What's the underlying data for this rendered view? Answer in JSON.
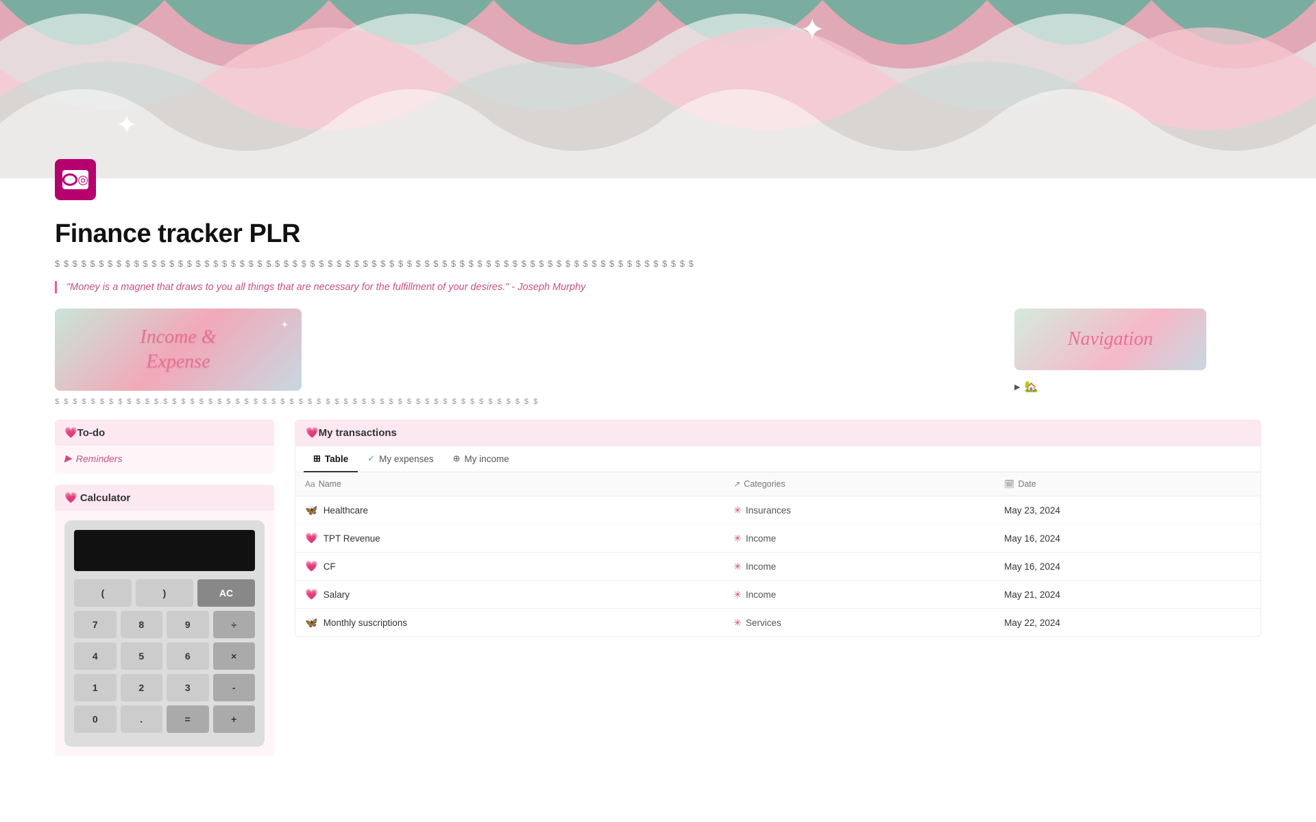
{
  "hero": {
    "alt": "Decorative wavy banner"
  },
  "page": {
    "icon_alt": "Finance tracker icon",
    "title": "Finance tracker PLR",
    "divider": "$ $ $ $ $ $ $ $ $ $ $ $ $ $ $ $ $ $ $ $ $ $ $ $ $ $ $ $ $ $ $ $ $ $ $ $ $ $ $ $ $ $ $ $ $ $ $ $ $ $ $ $ $ $ $ $ $ $ $ $ $ $ $ $ $ $ $ $ $ $ $ $ $",
    "quote": "\"Money is a magnet that draws to you all things that are necessary for the fulfillment of your desires.\" - Joseph Murphy",
    "income_banner_text": "Income &\nExpense",
    "wave2": "$ $ $ $ $ $ $ $ $ $ $ $ $ $ $ $ $ $ $ $ $ $ $ $ $ $ $ $ $ $ $ $ $ $ $ $ $ $ $ $ $ $ $ $ $ $ $ $ $ $ $ $ $ $"
  },
  "navigation": {
    "title": "Navigation",
    "toggle_icon": "▶",
    "toggle_emoji": "🏡"
  },
  "todo": {
    "header": "💗To-do",
    "reminders_icon": "▶",
    "reminders_label": "Reminders"
  },
  "calculator": {
    "header": "💗 Calculator",
    "buttons": [
      [
        "(",
        ")",
        "AC"
      ],
      [
        "7",
        "8",
        "9",
        "÷"
      ],
      [
        "4",
        "5",
        "6",
        "×"
      ],
      [
        "1",
        "2",
        "3",
        "-"
      ],
      [
        "0",
        ".",
        "=",
        "+"
      ]
    ]
  },
  "transactions": {
    "header": "💗My transactions",
    "tabs": [
      {
        "label": "Table",
        "icon": "⊞",
        "active": true
      },
      {
        "label": "My expenses",
        "icon": "✓",
        "active": false
      },
      {
        "label": "My income",
        "icon": "⊕",
        "active": false
      }
    ],
    "columns": [
      {
        "label": "Name",
        "icon": "Aa"
      },
      {
        "label": "Categories",
        "icon": "↗"
      },
      {
        "label": "Date",
        "icon": "📅"
      }
    ],
    "rows": [
      {
        "emoji": "🦋",
        "name": "Healthcare",
        "category": "Insurances",
        "date": "May 23, 2024"
      },
      {
        "emoji": "💗",
        "name": "TPT Revenue",
        "category": "Income",
        "date": "May 16, 2024"
      },
      {
        "emoji": "💗",
        "name": "CF",
        "category": "Income",
        "date": "May 16, 2024"
      },
      {
        "emoji": "💗",
        "name": "Salary",
        "category": "Income",
        "date": "May 21, 2024"
      },
      {
        "emoji": "🦋",
        "name": "Monthly suscriptions",
        "category": "Services",
        "date": "May 22, 2024"
      }
    ]
  }
}
